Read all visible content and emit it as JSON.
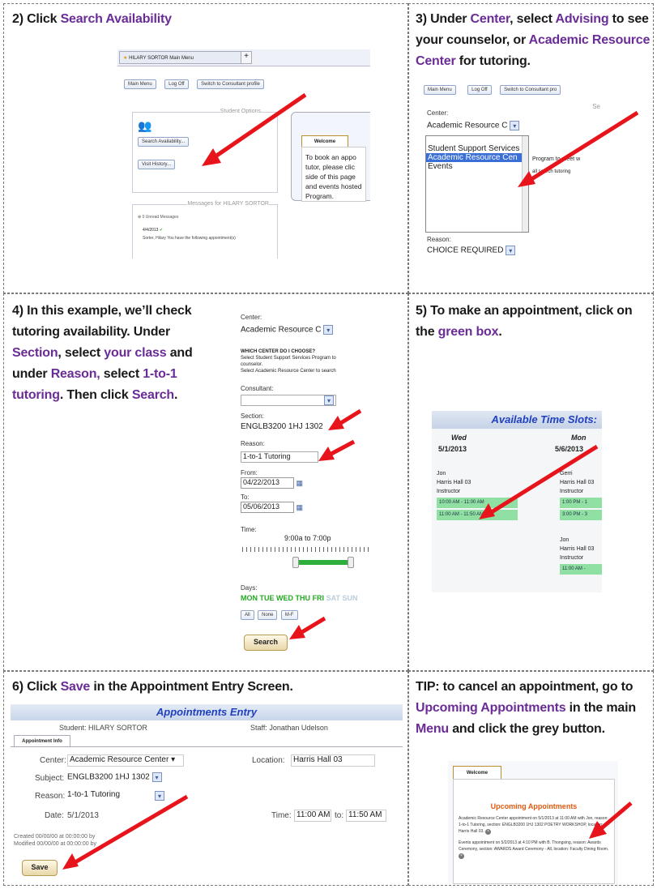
{
  "s2": {
    "h1": "2) Click ",
    "h2": "Search Availability",
    "tab": "HILARY SORTOR Main Menu",
    "tab_plus": "+",
    "btns": [
      "Main Menu",
      "Log Off",
      "Switch to Consultant profile"
    ],
    "student_options": "Student Options",
    "search_btn": "Search Availability...",
    "visit_btn": "Visit History...",
    "messages": "Messages for HILARY SORTOR",
    "msg1": "0 Unread Messages",
    "msg_date": "4/4/2013",
    "msg_body": "Sorter, Hilary You have the following appointment(s)",
    "welcome": "Welcome",
    "welcome_text": "To book an appo tutor, please clic side of this page and events hosted Program."
  },
  "s3": {
    "h1": "3) Under ",
    "h2": "Center",
    "h3": ", select ",
    "h4": "Advising",
    "h5": " to see your counselor, or ",
    "h6": "Academic Resource Center",
    "h7": " for tutoring.",
    "btns": [
      "Main Menu",
      "Log Off",
      "Switch to Consultant pro"
    ],
    "center_label": "Center:",
    "center_value": "Academic Resource C",
    "options": [
      "Student Support Services",
      "Academic Resource Cen",
      "Events"
    ],
    "side1": "Program to meet w",
    "side2": "all search tutoring",
    "reason_label": "Reason:",
    "reason_value": "CHOICE REQUIRED",
    "corner": "Se"
  },
  "s4": {
    "l1": "4) In this example, we’ll check",
    "l2": "tutoring availability. Under",
    "l3a": "Section",
    "l3b": ", select ",
    "l3c": "your class",
    "l3d": " and",
    "l4a": "under ",
    "l4b": "Reason,",
    "l4c": " select ",
    "l4d": "1-to-1",
    "l5a": "tutoring",
    "l5b": ". Then click ",
    "l5c": "Search",
    "l5d": ".",
    "center_label": "Center:",
    "center_value": "Academic Resource C",
    "which": "WHICH CENTER DO I CHOOSE?",
    "which1": "Select Student Support Services Program to",
    "which2": "counselor.",
    "which3": "Select Academic Resource Center to search",
    "consultant": "Consultant:",
    "section_label": "Section:",
    "section_value": "ENGLB3200 1HJ 1302",
    "reason_label": "Reason:",
    "reason_value": "1-to-1 Tutoring",
    "from_label": "From:",
    "from_value": "04/22/2013",
    "to_label": "To:",
    "to_value": "05/06/2013",
    "time_label": "Time:",
    "time_value": "9:00a to 7:00p",
    "days_label": "Days:",
    "days": [
      "MON",
      "TUE",
      "WED",
      "THU",
      "FRI",
      "SAT",
      "SUN"
    ],
    "day_btns": [
      "All",
      "None",
      "M-F"
    ],
    "search": "Search"
  },
  "s5": {
    "h1": "5) To make an appointment, click on the ",
    "h2": "green box",
    ".": ".",
    "h3": ".",
    "title": "Available Time Slots:",
    "col1_day": "Wed",
    "col1_date": "5/1/2013",
    "col2_day": "Mon",
    "col2_date": "5/6/2013",
    "c1_name": "Jon",
    "c1_loc": "Harris Hall 03",
    "c1_role": "Instructor",
    "c1_slots": [
      "10:00 AM - 11:00 AM",
      "11:00 AM - 11:50 AM"
    ],
    "c2_name": "Gerri",
    "c2_loc": "Harris Hall 03",
    "c2_role": "Instructor",
    "c2_slots": [
      "1:00 PM - 1",
      "3:00 PM - 3"
    ],
    "c3_name": "Jon",
    "c3_loc": "Harris Hall 03",
    "c3_role": "Instructor",
    "c3_slots": [
      "11:00 AM -"
    ]
  },
  "s6": {
    "h1": "6) Click ",
    "h2": "Save",
    "h3": " in the Appointment Entry Screen.",
    "title": "Appointments Entry",
    "student": "Student: HILARY SORTOR",
    "staff": "Staff: Jonathan Udelson",
    "tab": "Appointment Info",
    "center_label": "Center:",
    "center_value": "Academic Resource Center",
    "location_label": "Location:",
    "location_value": "Harris Hall 03",
    "subject_label": "Subject:",
    "subject_value": "ENGLB3200 1HJ 1302",
    "reason_label": "Reason:",
    "reason_value": "1-to-1 Tutoring",
    "date_label": "Date:",
    "date_value": "5/1/2013",
    "time_label": "Time:",
    "time_from": "11:00 AM",
    "time_to_label": "to:",
    "time_to": "11:50 AM",
    "created": "Created 00/00/00 at 00:00:00 by",
    "modified": "Modified 00/00/00 at 00:00:00 by",
    "save": "Save"
  },
  "tip": {
    "h1": "TIP: to cancel an appointment, go to ",
    "h2": "Upcoming Appointments",
    "h3": " in the main ",
    "h4": "Menu",
    "h5": " and click the grey button.",
    "welcome": "Welcome",
    "upcoming": "Upcoming Appointments",
    "appt1": "Academic Resource Center appointment on 5/1/2013 at 11:00 AM with Jon, reason: 1-to-1 Tutoring, section: ENGLB3200 1HJ 1302 POETRY WORKSHOP, location: Harris Hall 03.",
    "appt2": "Events appointment on 5/2/2013 at 4:10 PM with B. Thongsing, reason: Awards Ceremony, section: AWARDS Award Ceremony - All, location: Faculty Dining Room."
  },
  "colors": {
    "highlight": "#6a2c96",
    "arrow": "#e8141b",
    "slot": "#90e0a4",
    "title_blue": "#2040c0"
  }
}
